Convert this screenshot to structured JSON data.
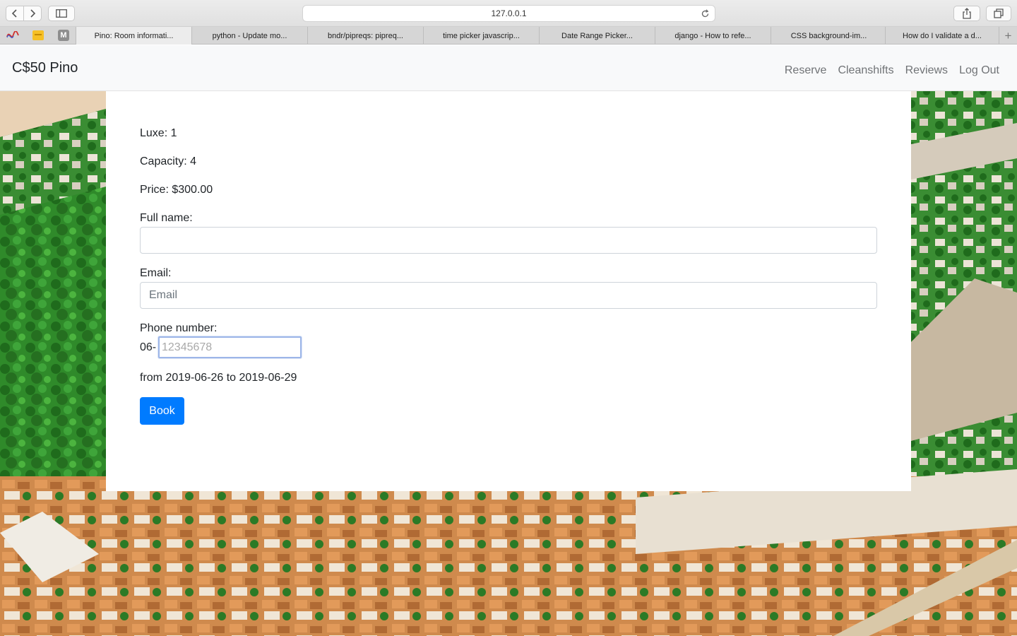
{
  "browser": {
    "url": "127.0.0.1",
    "tabs": [
      {
        "label": "Pino: Room informati...",
        "active": true
      },
      {
        "label": "python - Update mo...",
        "active": false
      },
      {
        "label": "bndr/pipreqs: pipreq...",
        "active": false
      },
      {
        "label": "time picker javascrip...",
        "active": false
      },
      {
        "label": "Date Range Picker...",
        "active": false
      },
      {
        "label": "django - How to refe...",
        "active": false
      },
      {
        "label": "CSS background-im...",
        "active": false
      },
      {
        "label": "How do I validate a d...",
        "active": false
      }
    ],
    "favorites": {
      "m_letter": "M"
    },
    "new_tab": "+"
  },
  "navbar": {
    "brand": "C$50 Pino",
    "links": [
      "Reserve",
      "Cleanshifts",
      "Reviews",
      "Log Out"
    ]
  },
  "room": {
    "luxe": "Luxe: 1",
    "capacity": "Capacity: 4",
    "price": "Price: $300.00"
  },
  "form": {
    "full_name_label": "Full name:",
    "full_name_value": "",
    "email_label": "Email:",
    "email_placeholder": "Email",
    "phone_label": "Phone number:",
    "phone_prefix": "06-",
    "phone_placeholder": "12345678",
    "dates": "from 2019-06-26 to 2019-06-29",
    "submit_label": "Book"
  },
  "colors": {
    "primary": "#007bff",
    "navbar_bg": "#f8f9fa",
    "nav_link": "#707376"
  }
}
